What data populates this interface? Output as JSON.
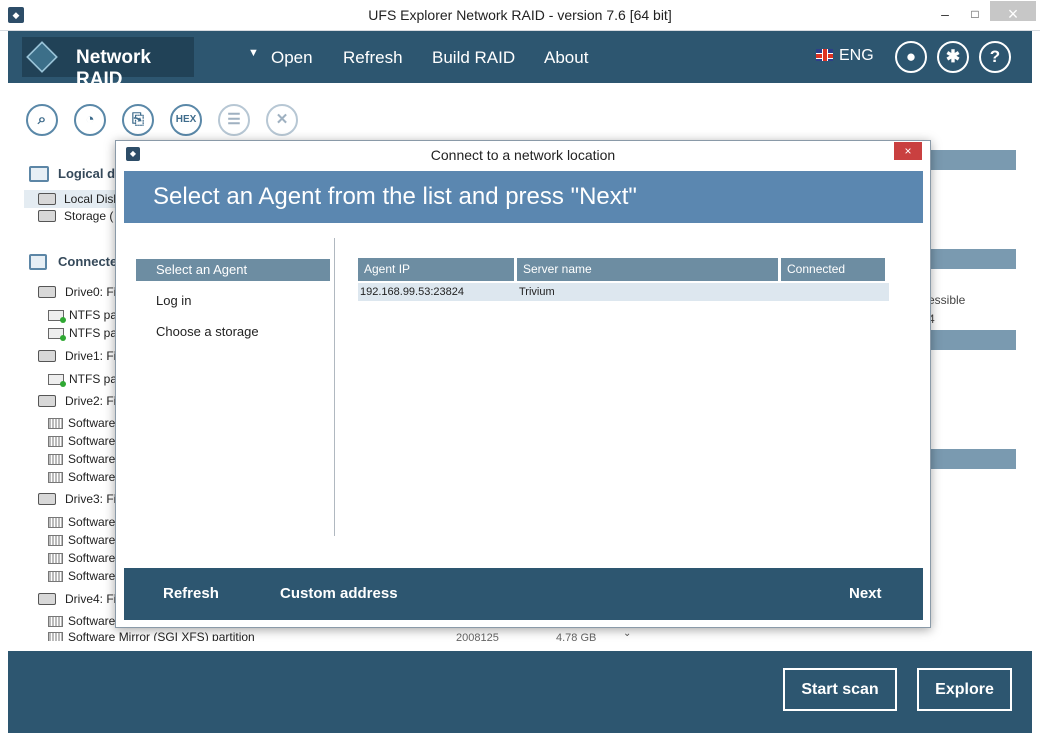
{
  "window": {
    "title": "UFS Explorer Network RAID - version 7.6 [64 bit]",
    "min": "–",
    "max": "□",
    "close": "×"
  },
  "appbar": {
    "brand": "Network RAID",
    "menu": [
      "Open",
      "Refresh",
      "Build RAID",
      "About"
    ],
    "language": "ENG"
  },
  "toolbar": {
    "hex_label": "HEX"
  },
  "tree": {
    "logical_header": "Logical di",
    "logical_items": [
      "Local Disk",
      "Storage ("
    ],
    "connected_header": "Connecte",
    "rows": [
      {
        "type": "drive",
        "label": "Drive0: Fi"
      },
      {
        "type": "part",
        "label": "NTFS pa"
      },
      {
        "type": "part",
        "label": "NTFS pa"
      },
      {
        "type": "drive",
        "label": "Drive1: Fi"
      },
      {
        "type": "part",
        "label": "NTFS pa"
      },
      {
        "type": "drive",
        "label": "Drive2: Fi"
      },
      {
        "type": "soft",
        "label": "Software"
      },
      {
        "type": "soft",
        "label": "Software"
      },
      {
        "type": "soft",
        "label": "Software"
      },
      {
        "type": "soft",
        "label": "Software"
      },
      {
        "type": "drive",
        "label": "Drive3: Fi"
      },
      {
        "type": "soft",
        "label": "Software"
      },
      {
        "type": "soft",
        "label": "Software"
      },
      {
        "type": "soft",
        "label": "Software"
      },
      {
        "type": "soft",
        "label": "Software"
      },
      {
        "type": "drive",
        "label": "Drive4: Fi"
      },
      {
        "type": "soft",
        "label": "Software"
      }
    ],
    "last_row": {
      "label": "Software Mirror (SGI XFS) partition",
      "sectors": "2008125",
      "size": "4.78 GB"
    }
  },
  "right_panel": {
    "text1": "essible",
    "text2": "4"
  },
  "bottom": {
    "start_scan": "Start scan",
    "explore": "Explore"
  },
  "dialog": {
    "title": "Connect to a network location",
    "close": "×",
    "banner": "Select an Agent from the list and press \"Next\"",
    "steps": [
      "Select an Agent",
      "Log in",
      "Choose a storage"
    ],
    "columns": [
      "Agent IP",
      "Server name",
      "Connected"
    ],
    "rows": [
      {
        "ip": "192.168.99.53:23824",
        "server": "Trivium",
        "connected": ""
      }
    ],
    "footer": {
      "refresh": "Refresh",
      "custom": "Custom address",
      "next": "Next"
    }
  }
}
